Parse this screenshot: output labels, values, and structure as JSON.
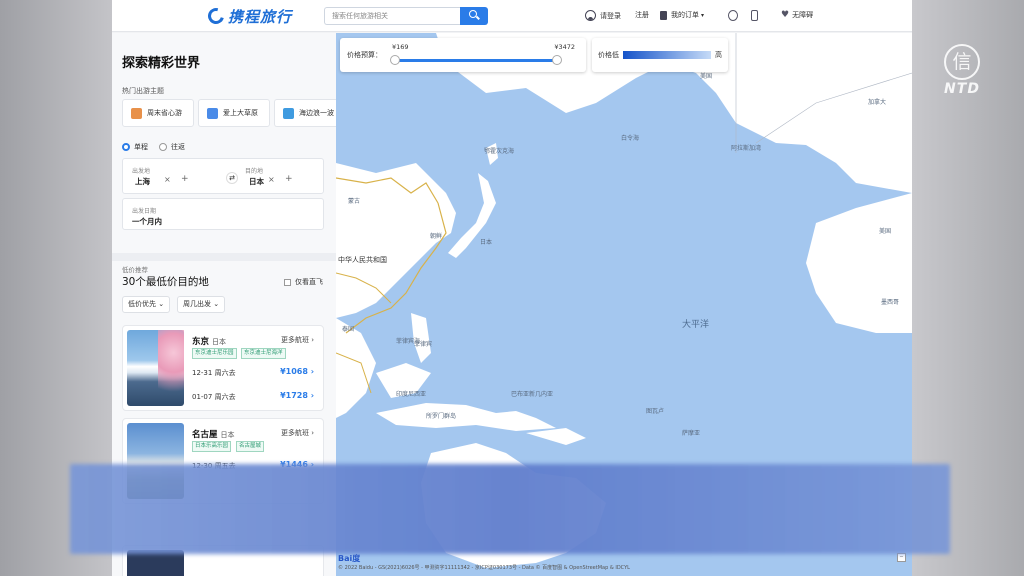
{
  "watermark": {
    "seal": "信",
    "text": "NTD"
  },
  "header": {
    "logo_text": "携程旅行",
    "search_placeholder": "搜索任何旅游相关",
    "login": "请登录",
    "register": "注册",
    "orders": "我的订单",
    "accessibility": "无障碍"
  },
  "panel": {
    "title": "探索精彩世界",
    "themes_label": "热门出游主题",
    "themes": [
      "周末省心游",
      "爱上大草原",
      "海边浪一波"
    ],
    "trip_types": [
      "单程",
      "往返"
    ],
    "from_label": "出发地",
    "from_value": "上海",
    "to_label": "目的地",
    "to_value": "日本",
    "date_label": "出发日期",
    "date_value": "一个月内",
    "rec_sub": "低价推荐",
    "rec_title": "30个最低价目的地",
    "nonstop": "仅看直飞",
    "filters": [
      "低价优先",
      "周几出发"
    ]
  },
  "cards": [
    {
      "dest": "东京",
      "country": "日本",
      "more": "更多航班",
      "tags": [
        "东京迪士尼乐园",
        "东京迪士尼海洋"
      ],
      "flights": [
        {
          "date": "12-31 周六去",
          "price": "¥1068"
        },
        {
          "date": "01-07 周六去",
          "price": "¥1728"
        }
      ]
    },
    {
      "dest": "名古屋",
      "country": "日本",
      "more": "更多航班",
      "tags": [
        "日本乐高乐园",
        "名古屋城"
      ],
      "flights": [
        {
          "date": "12-30 周五去",
          "price": "¥1446"
        }
      ]
    }
  ],
  "price_filter": {
    "label": "价格预算：",
    "min": "¥169",
    "max": "¥3472"
  },
  "legend": {
    "low": "价格低",
    "high": "高"
  },
  "map_labels": {
    "pacific": "大平洋",
    "philippine_sea": "菲律宾海",
    "bering_sea": "白令海",
    "okhotsk": "鄂霍次克海",
    "gulf_alaska": "阿拉斯加湾",
    "china": "中华人民共和国",
    "mongolia": "蒙古",
    "korea": "朝鲜",
    "japan": "日本",
    "usa": "美国",
    "canada": "加拿大",
    "mexico": "墨西哥",
    "thailand": "泰国",
    "philippines": "菲律宾",
    "indonesia": "印度尼西亚",
    "png": "巴布亚新几内亚",
    "solomon": "所罗门群岛",
    "tuvalu": "图瓦卢",
    "samoa": "萨摩亚"
  },
  "baidu": {
    "logo_a": "Bai",
    "logo_b": "度",
    "copyright": "© 2022 Baidu - GS(2021)6026号 - 甲测资字11111342 - 京ICP证030173号 - Data © 百度智图 & OpenStreetMap & IDCYL"
  },
  "colors": {
    "accent": "#2a7ce8",
    "ocean": "#a4c7ef",
    "land": "#ffffff",
    "border": "#d8b24a"
  }
}
